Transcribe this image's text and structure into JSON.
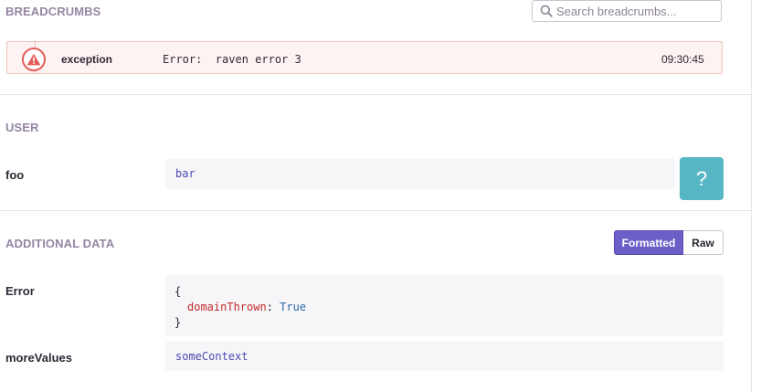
{
  "breadcrumbs": {
    "title": "BREADCRUMBS",
    "search_placeholder": "Search breadcrumbs...",
    "items": [
      {
        "category": "exception",
        "message": "Error:  raven error 3",
        "time": "09:30:45",
        "icon": "warning-icon",
        "color": "#e55b58"
      }
    ]
  },
  "user": {
    "title": "USER",
    "rows": [
      {
        "key": "foo",
        "value": "bar"
      }
    ],
    "help_label": "?"
  },
  "additional_data": {
    "title": "ADDITIONAL DATA",
    "view_toggle": {
      "formatted": "Formatted",
      "raw": "Raw",
      "selected": "Formatted"
    },
    "rows": [
      {
        "key": "Error",
        "open_brace": "{",
        "json_key": "domainThrown",
        "colon": ":",
        "json_value": "True",
        "close_brace": "}"
      },
      {
        "key": "moreValues",
        "value": "someContext"
      }
    ]
  },
  "colors": {
    "accent": "#6c5fc7",
    "help": "#57b6c4",
    "error": "#e55b58",
    "section_title": "#9585a3"
  }
}
